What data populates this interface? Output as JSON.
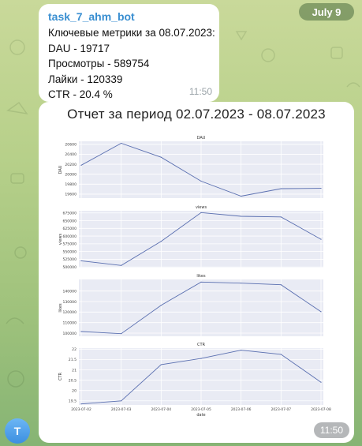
{
  "date_pill": "July 9",
  "message": {
    "sender": "task_7_ahm_bot",
    "lines": [
      "Ключевые метрики за 08.07.2023:",
      "DAU - 19717",
      "Просмотры - 589754",
      "Лайки - 120339",
      "CTR - 20.4 %"
    ],
    "time": "11:50"
  },
  "image_message": {
    "title": "Отчет за период 02.07.2023 - 08.07.2023",
    "time": "11:50"
  },
  "avatar_letter": "T",
  "colors": {
    "line": "#5a6fb0",
    "plot_bg": "#e9ebf4",
    "grid": "#ffffff",
    "link": "#3a8fd1"
  },
  "chart_data": [
    {
      "type": "line",
      "title": "DAU",
      "ylabel": "DAU",
      "xlabel": "",
      "x": [
        "2023-07-02",
        "2023-07-03",
        "2023-07-04",
        "2023-07-05",
        "2023-07-06",
        "2023-07-07",
        "2023-07-08"
      ],
      "values": [
        20180,
        20620,
        20340,
        19860,
        19560,
        19710,
        19717
      ],
      "yticks": [
        19600,
        19800,
        20000,
        20200,
        20400,
        20600
      ],
      "ylim": [
        19520,
        20660
      ],
      "grid": true
    },
    {
      "type": "line",
      "title": "views",
      "ylabel": "views",
      "xlabel": "",
      "x": [
        "2023-07-02",
        "2023-07-03",
        "2023-07-04",
        "2023-07-05",
        "2023-07-06",
        "2023-07-07",
        "2023-07-08"
      ],
      "values": [
        520000,
        505000,
        583000,
        676000,
        664000,
        662000,
        589754
      ],
      "yticks": [
        500000,
        525000,
        550000,
        575000,
        600000,
        625000,
        650000,
        675000
      ],
      "ylim": [
        498000,
        682000
      ],
      "grid": true
    },
    {
      "type": "line",
      "title": "likes",
      "ylabel": "likes",
      "xlabel": "",
      "x": [
        "2023-07-02",
        "2023-07-03",
        "2023-07-04",
        "2023-07-05",
        "2023-07-06",
        "2023-07-07",
        "2023-07-08"
      ],
      "values": [
        101500,
        99500,
        126500,
        148500,
        147500,
        146000,
        120339
      ],
      "yticks": [
        100000,
        110000,
        120000,
        130000,
        140000
      ],
      "ylim": [
        97000,
        151000
      ],
      "grid": true
    },
    {
      "type": "line",
      "title": "CTR",
      "ylabel": "CTR",
      "xlabel": "date",
      "x": [
        "2023-07-02",
        "2023-07-03",
        "2023-07-04",
        "2023-07-05",
        "2023-07-06",
        "2023-07-07",
        "2023-07-08"
      ],
      "values": [
        19.35,
        19.5,
        21.25,
        21.55,
        21.95,
        21.75,
        20.4
      ],
      "yticks": [
        19.5,
        20.0,
        20.5,
        21.0,
        21.5,
        22.0
      ],
      "ylim": [
        19.3,
        22.05
      ],
      "grid": true
    }
  ]
}
